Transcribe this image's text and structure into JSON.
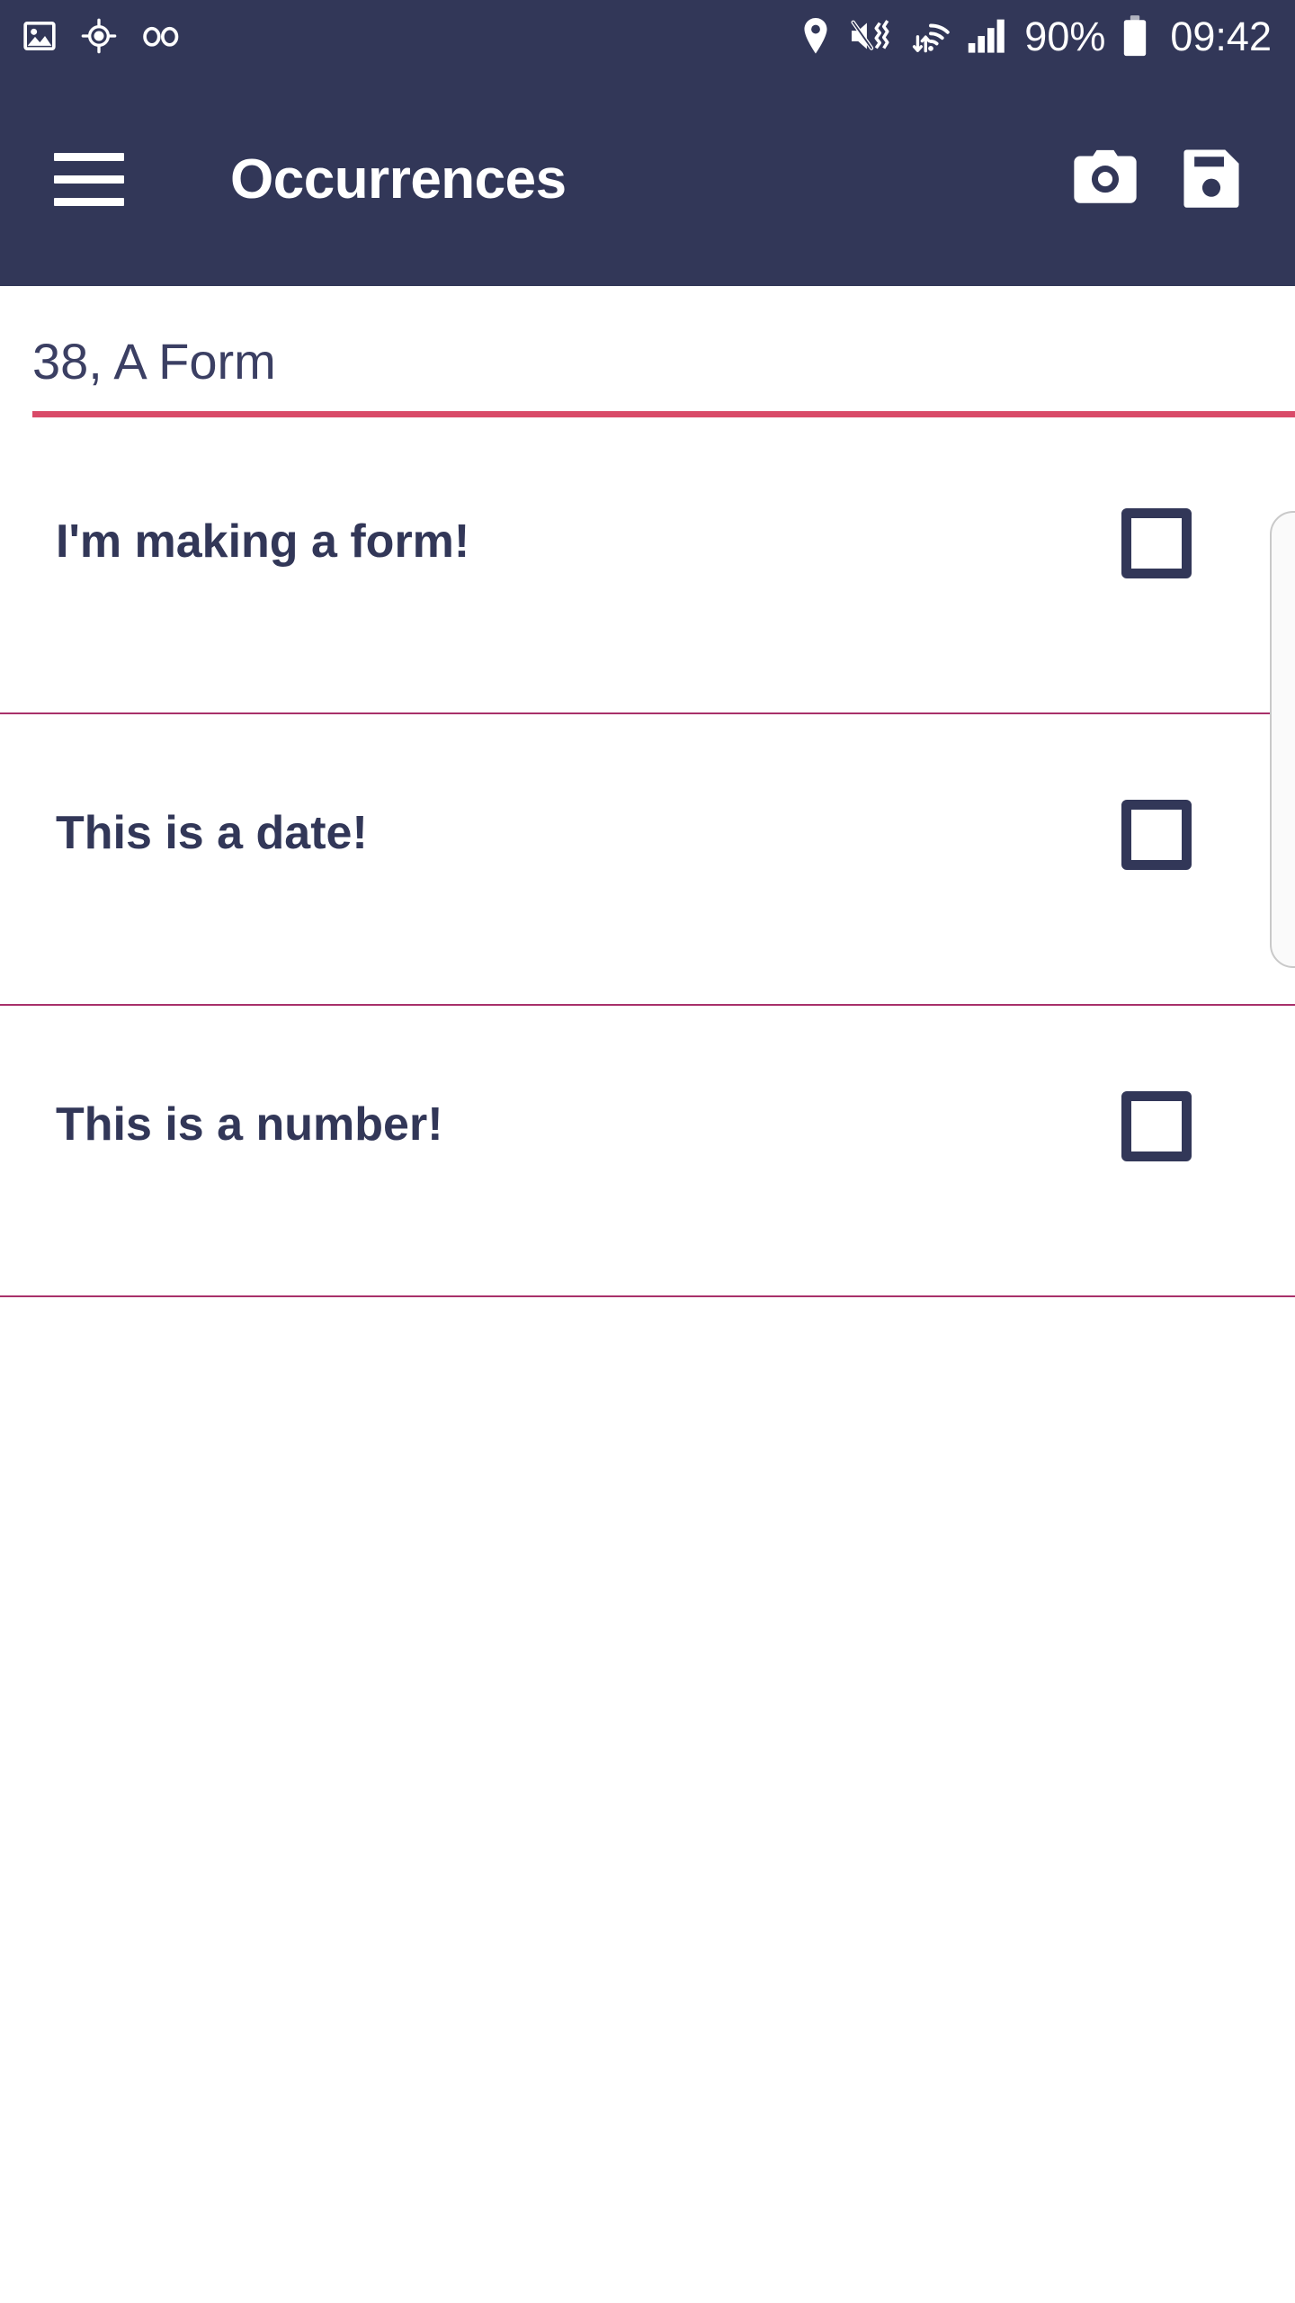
{
  "status_bar": {
    "left_icons": [
      {
        "name": "image-icon",
        "label": "Screenshot"
      },
      {
        "name": "gps-fixed-icon",
        "label": "Location active"
      },
      {
        "name": "voicemail-icon",
        "label": "Voicemail"
      }
    ],
    "right_icons": [
      {
        "name": "location-pin-icon",
        "label": "Location"
      },
      {
        "name": "volume-mute-vibrate-icon",
        "label": "Silent with vibrate"
      },
      {
        "name": "wifi-data-icon",
        "label": "Wi-Fi"
      },
      {
        "name": "cellular-signal-icon",
        "label": "Signal"
      }
    ],
    "battery_percent": "90%",
    "battery_icon": "battery-full-icon",
    "clock": "09:42"
  },
  "app_bar": {
    "menu_icon": "hamburger-menu-icon",
    "title": "Occurrences",
    "actions": [
      {
        "name": "camera-button",
        "icon": "camera-icon",
        "label": "Camera"
      },
      {
        "name": "save-button",
        "icon": "floppy-disk-save-icon",
        "label": "Save"
      }
    ]
  },
  "form": {
    "title_value": "38, A Form",
    "title_placeholder": "Form name",
    "underline_color": "#d94a68"
  },
  "occurrences": [
    {
      "label": "I'm making a form!",
      "checked": false
    },
    {
      "label": "This is a date!",
      "checked": false
    },
    {
      "label": "This is a number!",
      "checked": false
    }
  ],
  "colors": {
    "primary": "#323758",
    "accent": "#d94a68",
    "divider": "#a8306a",
    "background": "#ffffff",
    "on_primary": "#ffffff"
  },
  "scroll_indicator": {
    "name": "vertical-scroll-panel"
  }
}
